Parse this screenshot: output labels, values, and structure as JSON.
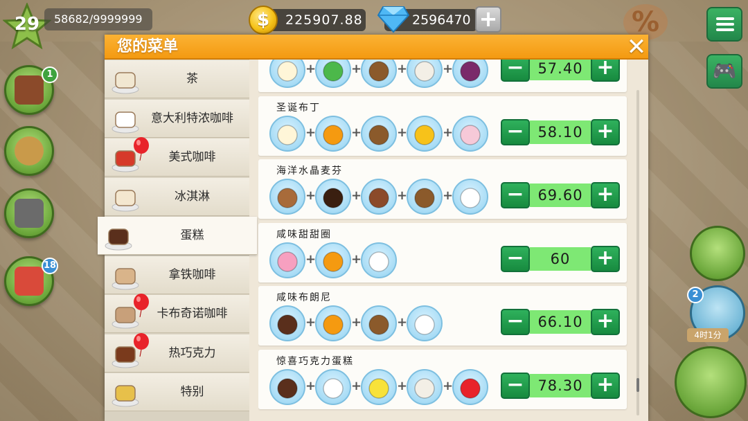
{
  "hud": {
    "level": "29",
    "xp": "58682/9999999",
    "coins": "225907.88",
    "gems": "2596470",
    "add_label": "+",
    "percent_label": "%"
  },
  "side_badges": {
    "recipes": "1",
    "gifts": "18",
    "orders": "2"
  },
  "timer": "4时1分",
  "panel": {
    "title": "您的菜单",
    "close_label": "✕"
  },
  "categories": [
    {
      "label": "茶",
      "icon": "tea-icon"
    },
    {
      "label": "意大利特浓咖啡",
      "icon": "espresso-icon"
    },
    {
      "label": "美式咖啡",
      "icon": "americano-icon"
    },
    {
      "label": "冰淇淋",
      "icon": "ice-cream-icon"
    },
    {
      "label": "蛋糕",
      "icon": "cake-icon"
    },
    {
      "label": "拿铁咖啡",
      "icon": "latte-icon"
    },
    {
      "label": "卡布奇诺咖啡",
      "icon": "cappuccino-icon"
    },
    {
      "label": "热巧克力",
      "icon": "hot-chocolate-icon"
    },
    {
      "label": "特别",
      "icon": "special-icon"
    }
  ],
  "active_category": "蛋糕",
  "items": [
    {
      "name": "",
      "price": "57.40",
      "ingredients": [
        "pudding-icon",
        "mint-icon",
        "hazelnut-icon",
        "coconut-icon",
        "berries-icon"
      ]
    },
    {
      "name": "圣诞布丁",
      "price": "58.10",
      "ingredients": [
        "pudding-icon",
        "syrup-drop-icon",
        "hazelnut-icon",
        "honeycomb-icon",
        "marshmallow-icon"
      ]
    },
    {
      "name": "海洋水晶麦芬",
      "price": "69.60",
      "ingredients": [
        "cupcake-icon",
        "chocolate-drop-icon",
        "chocolate-bar-icon",
        "hazelnut-icon",
        "sugar-icon"
      ]
    },
    {
      "name": "咸味甜甜圈",
      "price": "60",
      "ingredients": [
        "donut-icon",
        "syrup-drop-icon",
        "sugar-icon"
      ]
    },
    {
      "name": "咸味布朗尼",
      "price": "66.10",
      "ingredients": [
        "cake-slice-icon",
        "syrup-drop-icon",
        "hazelnut-icon",
        "sugar-icon"
      ]
    },
    {
      "name": "惊喜巧克力蛋糕",
      "price": "78.30",
      "ingredients": [
        "cake-slice-icon",
        "cream-icon",
        "lemon-icon",
        "coconut-icon",
        "red-drop-icon"
      ]
    }
  ],
  "stepper": {
    "minus_label": "−",
    "plus_label": "+"
  },
  "colors": {
    "header_orange": "#f49a12",
    "stepper_green": "#178a3f",
    "price_bg": "#7ee874",
    "ingredient_bg": "#a8dcf5"
  }
}
